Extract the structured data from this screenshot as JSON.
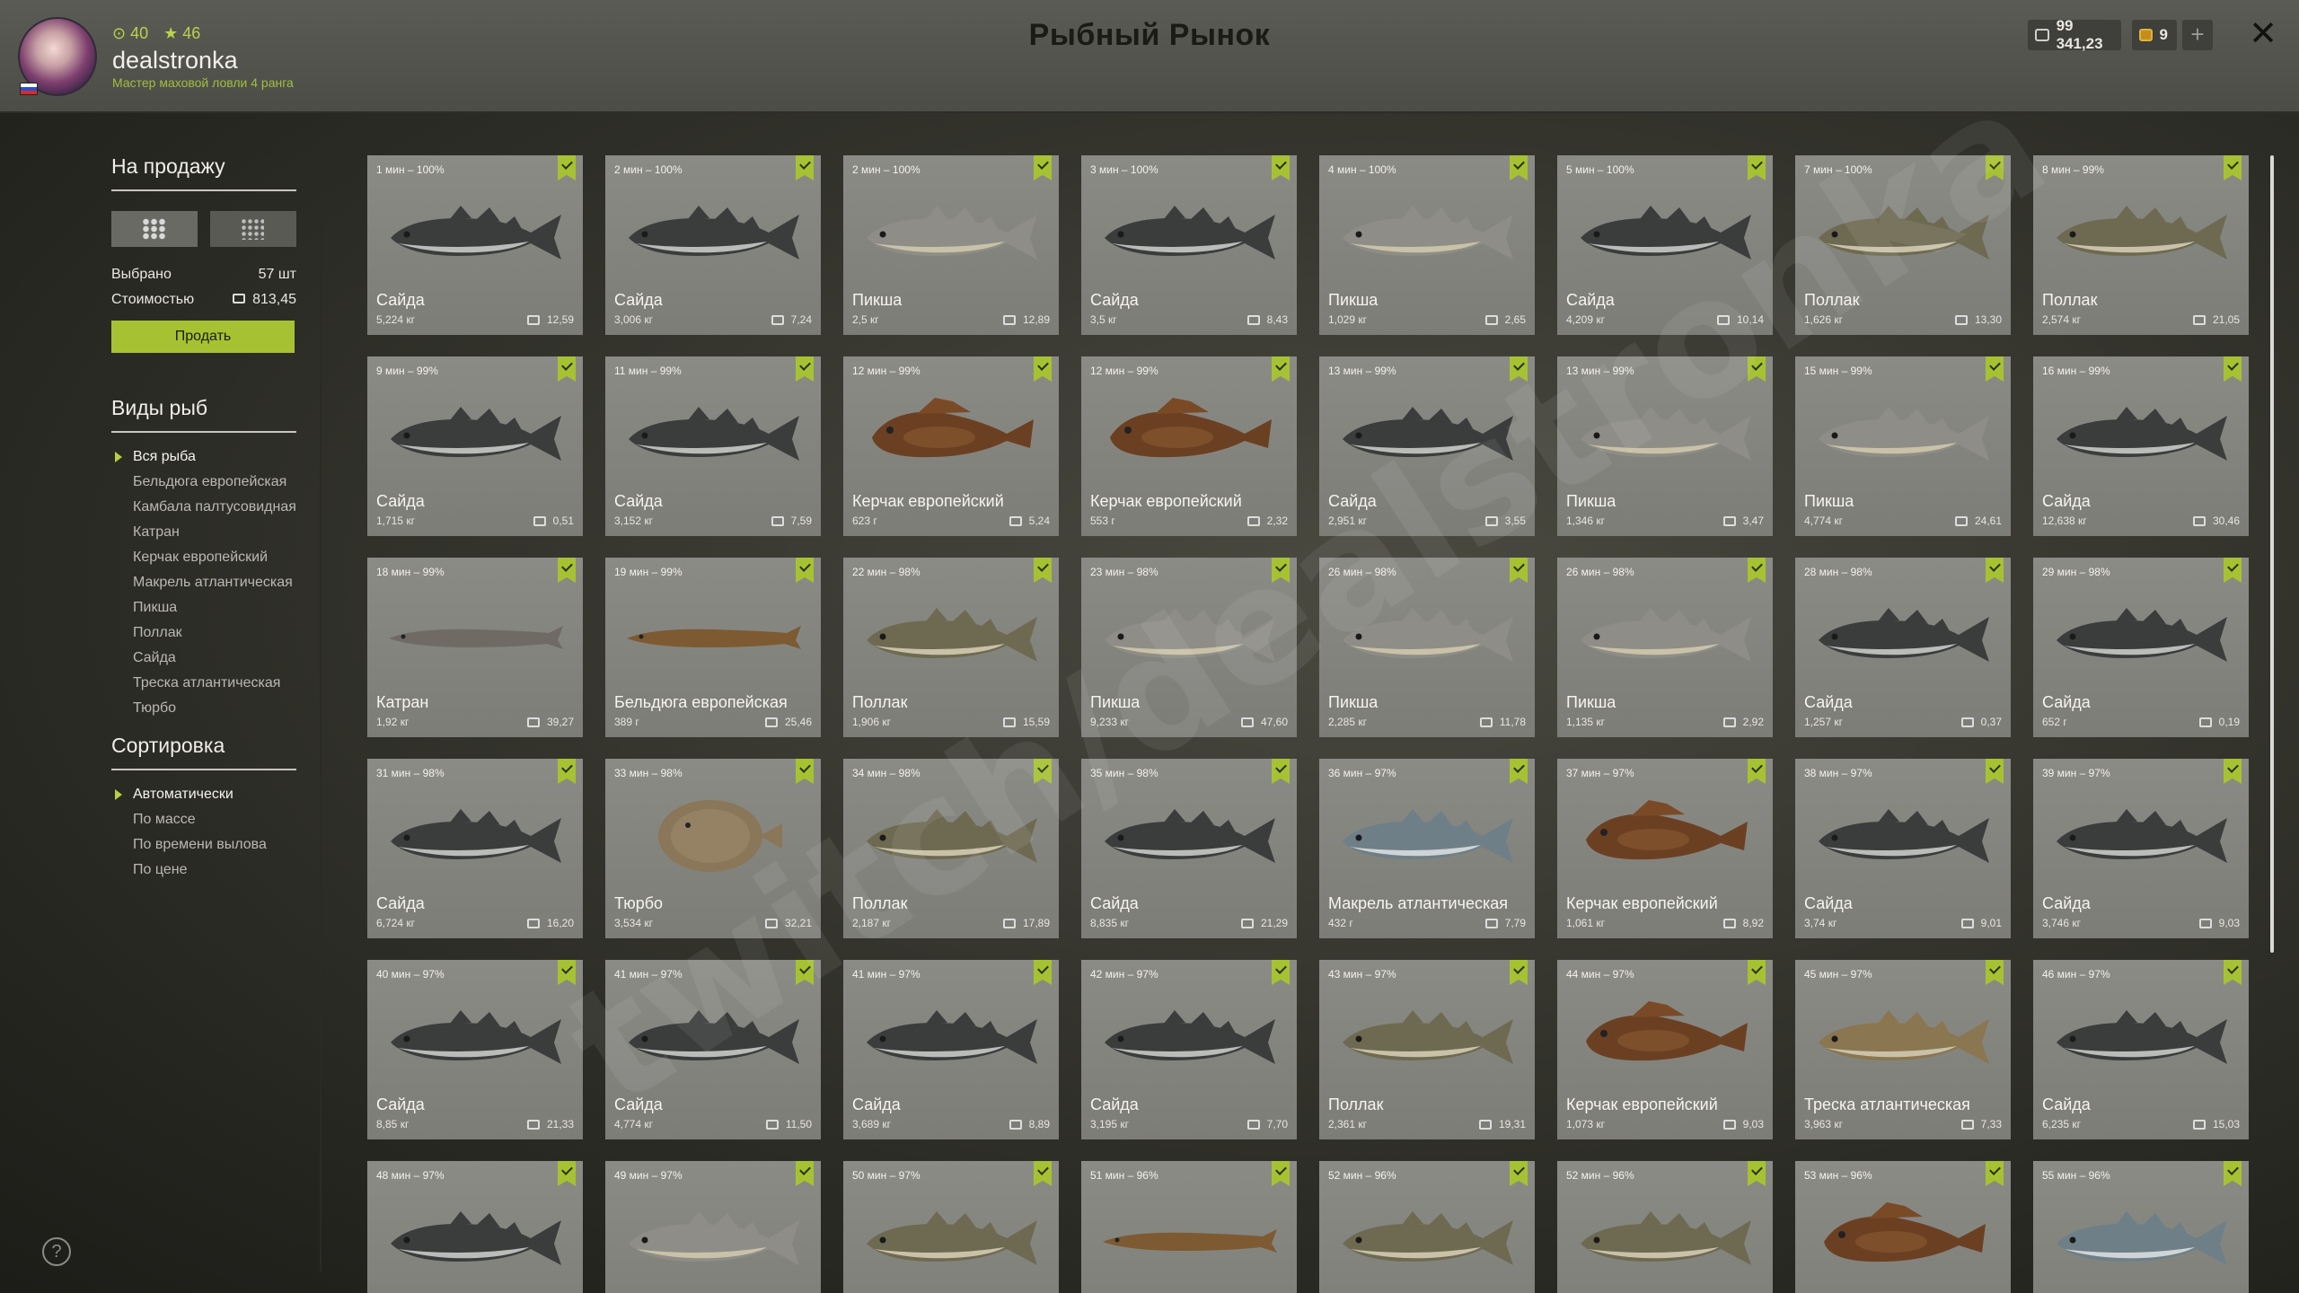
{
  "header": {
    "title": "Рыбный Рынок",
    "stat1": "40",
    "stat2": "46",
    "username": "dealstronka",
    "rank": "Мастер маховой ловли 4 ранга",
    "silver": "99 341,23",
    "gold": "9",
    "plus": "+",
    "close": "✕"
  },
  "sidebar": {
    "sale_title": "На продажу",
    "selected_label": "Выбрано",
    "selected_value": "57 шт",
    "cost_label": "Стоимостью",
    "cost_value": "813,45",
    "sell_button": "Продать",
    "species_title": "Виды рыб",
    "species": [
      "Вся рыба",
      "Бельдюга европейская",
      "Камбала палтусовидная",
      "Катран",
      "Керчак европейский",
      "Макрель атлантическая",
      "Пикша",
      "Поллак",
      "Сайда",
      "Треска атлантическая",
      "Тюрбо"
    ],
    "sort_title": "Сортировка",
    "sort": [
      "Автоматически",
      "По массе",
      "По времени вылова",
      "По цене"
    ],
    "help": "?"
  },
  "colors": {
    "accent": "#a6c232",
    "fish": {
      "saithe": "#3a3d3c",
      "haddock": "#8e8d87",
      "pollack": "#6e6a52",
      "sculpin": "#6b4022",
      "turbot": "#8a7658",
      "dogfish": "#6f6b64",
      "eelpout": "#7d5a32",
      "mackerel": "#6e7f87",
      "cod": "#8a7650"
    }
  },
  "watermark": "twitch/dealstronka",
  "cards": [
    {
      "time": "1 мин – 100%",
      "name": "Сайда",
      "weight": "5,224 кг",
      "price": "12,59",
      "kind": "saithe"
    },
    {
      "time": "2 мин – 100%",
      "name": "Сайда",
      "weight": "3,006 кг",
      "price": "7,24",
      "kind": "saithe"
    },
    {
      "time": "2 мин – 100%",
      "name": "Пикша",
      "weight": "2,5 кг",
      "price": "12,89",
      "kind": "haddock"
    },
    {
      "time": "3 мин – 100%",
      "name": "Сайда",
      "weight": "3,5 кг",
      "price": "8,43",
      "kind": "saithe"
    },
    {
      "time": "4 мин – 100%",
      "name": "Пикша",
      "weight": "1,029 кг",
      "price": "2,65",
      "kind": "haddock"
    },
    {
      "time": "5 мин – 100%",
      "name": "Сайда",
      "weight": "4,209 кг",
      "price": "10,14",
      "kind": "saithe"
    },
    {
      "time": "7 мин – 100%",
      "name": "Поллак",
      "weight": "1,626 кг",
      "price": "13,30",
      "kind": "pollack"
    },
    {
      "time": "8 мин – 99%",
      "name": "Поллак",
      "weight": "2,574 кг",
      "price": "21,05",
      "kind": "pollack"
    },
    {
      "time": "9 мин – 99%",
      "name": "Сайда",
      "weight": "1,715 кг",
      "price": "0,51",
      "kind": "saithe"
    },
    {
      "time": "11 мин – 99%",
      "name": "Сайда",
      "weight": "3,152 кг",
      "price": "7,59",
      "kind": "saithe"
    },
    {
      "time": "12 мин – 99%",
      "name": "Керчак европейский",
      "weight": "623 г",
      "price": "5,24",
      "kind": "sculpin"
    },
    {
      "time": "12 мин – 99%",
      "name": "Керчак европейский",
      "weight": "553 г",
      "price": "2,32",
      "kind": "sculpin"
    },
    {
      "time": "13 мин – 99%",
      "name": "Сайда",
      "weight": "2,951 кг",
      "price": "3,55",
      "kind": "saithe"
    },
    {
      "time": "13 мин – 99%",
      "name": "Пикша",
      "weight": "1,346 кг",
      "price": "3,47",
      "kind": "haddock"
    },
    {
      "time": "15 мин – 99%",
      "name": "Пикша",
      "weight": "4,774 кг",
      "price": "24,61",
      "kind": "haddock"
    },
    {
      "time": "16 мин – 99%",
      "name": "Сайда",
      "weight": "12,638 кг",
      "price": "30,46",
      "kind": "saithe"
    },
    {
      "time": "18 мин – 99%",
      "name": "Катран",
      "weight": "1,92 кг",
      "price": "39,27",
      "kind": "dogfish"
    },
    {
      "time": "19 мин – 99%",
      "name": "Бельдюга европейская",
      "weight": "389 г",
      "price": "25,46",
      "kind": "eelpout"
    },
    {
      "time": "22 мин – 98%",
      "name": "Поллак",
      "weight": "1,906 кг",
      "price": "15,59",
      "kind": "pollack"
    },
    {
      "time": "23 мин – 98%",
      "name": "Пикша",
      "weight": "9,233 кг",
      "price": "47,60",
      "kind": "haddock"
    },
    {
      "time": "26 мин – 98%",
      "name": "Пикша",
      "weight": "2,285 кг",
      "price": "11,78",
      "kind": "haddock"
    },
    {
      "time": "26 мин – 98%",
      "name": "Пикша",
      "weight": "1,135 кг",
      "price": "2,92",
      "kind": "haddock"
    },
    {
      "time": "28 мин – 98%",
      "name": "Сайда",
      "weight": "1,257 кг",
      "price": "0,37",
      "kind": "saithe"
    },
    {
      "time": "29 мин – 98%",
      "name": "Сайда",
      "weight": "652 г",
      "price": "0,19",
      "kind": "saithe"
    },
    {
      "time": "31 мин – 98%",
      "name": "Сайда",
      "weight": "6,724 кг",
      "price": "16,20",
      "kind": "saithe"
    },
    {
      "time": "33 мин – 98%",
      "name": "Тюрбо",
      "weight": "3,534 кг",
      "price": "32,21",
      "kind": "turbot"
    },
    {
      "time": "34 мин – 98%",
      "name": "Поллак",
      "weight": "2,187 кг",
      "price": "17,89",
      "kind": "pollack"
    },
    {
      "time": "35 мин – 98%",
      "name": "Сайда",
      "weight": "8,835 кг",
      "price": "21,29",
      "kind": "saithe"
    },
    {
      "time": "36 мин – 97%",
      "name": "Макрель атлантическая",
      "weight": "432 г",
      "price": "7,79",
      "kind": "mackerel"
    },
    {
      "time": "37 мин – 97%",
      "name": "Керчак европейский",
      "weight": "1,061 кг",
      "price": "8,92",
      "kind": "sculpin"
    },
    {
      "time": "38 мин – 97%",
      "name": "Сайда",
      "weight": "3,74 кг",
      "price": "9,01",
      "kind": "saithe"
    },
    {
      "time": "39 мин – 97%",
      "name": "Сайда",
      "weight": "3,746 кг",
      "price": "9,03",
      "kind": "saithe"
    },
    {
      "time": "40 мин – 97%",
      "name": "Сайда",
      "weight": "8,85 кг",
      "price": "21,33",
      "kind": "saithe"
    },
    {
      "time": "41 мин – 97%",
      "name": "Сайда",
      "weight": "4,774 кг",
      "price": "11,50",
      "kind": "saithe"
    },
    {
      "time": "41 мин – 97%",
      "name": "Сайда",
      "weight": "3,689 кг",
      "price": "8,89",
      "kind": "saithe"
    },
    {
      "time": "42 мин – 97%",
      "name": "Сайда",
      "weight": "3,195 кг",
      "price": "7,70",
      "kind": "saithe"
    },
    {
      "time": "43 мин – 97%",
      "name": "Поллак",
      "weight": "2,361 кг",
      "price": "19,31",
      "kind": "pollack"
    },
    {
      "time": "44 мин – 97%",
      "name": "Керчак европейский",
      "weight": "1,073 кг",
      "price": "9,03",
      "kind": "sculpin"
    },
    {
      "time": "45 мин – 97%",
      "name": "Треска атлантическая",
      "weight": "3,963 кг",
      "price": "7,33",
      "kind": "cod"
    },
    {
      "time": "46 мин – 97%",
      "name": "Сайда",
      "weight": "6,235 кг",
      "price": "15,03",
      "kind": "saithe"
    },
    {
      "time": "48 мин – 97%",
      "name": "",
      "weight": "",
      "price": "",
      "kind": "saithe"
    },
    {
      "time": "49 мин – 97%",
      "name": "",
      "weight": "",
      "price": "",
      "kind": "haddock"
    },
    {
      "time": "50 мин – 97%",
      "name": "",
      "weight": "",
      "price": "",
      "kind": "pollack"
    },
    {
      "time": "51 мин – 96%",
      "name": "",
      "weight": "",
      "price": "",
      "kind": "eelpout"
    },
    {
      "time": "52 мин – 96%",
      "name": "",
      "weight": "",
      "price": "",
      "kind": "pollack"
    },
    {
      "time": "52 мин – 96%",
      "name": "",
      "weight": "",
      "price": "",
      "kind": "pollack"
    },
    {
      "time": "53 мин – 96%",
      "name": "",
      "weight": "",
      "price": "",
      "kind": "sculpin"
    },
    {
      "time": "55 мин – 96%",
      "name": "",
      "weight": "",
      "price": "",
      "kind": "mackerel"
    }
  ]
}
